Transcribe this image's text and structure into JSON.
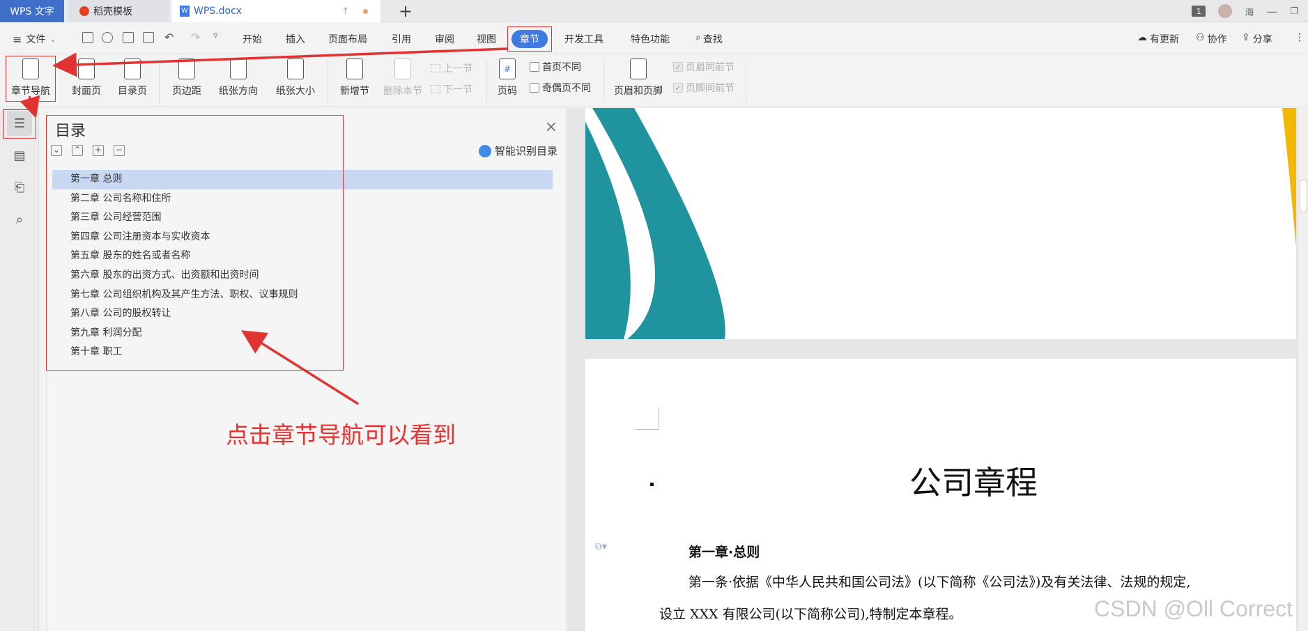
{
  "titlebar": {
    "tabs": [
      {
        "label": "WPS 文字"
      },
      {
        "label": "稻壳模板"
      },
      {
        "label": "WPS.docx"
      }
    ],
    "window_count": "1",
    "user_name": "海",
    "new_tab_icon": "plus-icon"
  },
  "menubar": {
    "file": "文件",
    "items": [
      "开始",
      "插入",
      "页面布局",
      "引用",
      "审阅",
      "视图",
      "章节",
      "开发工具",
      "特色功能",
      "查找"
    ],
    "active_item": "章节",
    "right": {
      "update": "有更新",
      "collab": "协作",
      "share": "分享"
    }
  },
  "ribbon": {
    "section_nav": "章节导航",
    "cover_page": "封面页",
    "toc_page": "目录页",
    "margins": "页边距",
    "orientation": "纸张方向",
    "paper_size": "纸张大小",
    "new_section": "新增节",
    "delete_section": "删除本节",
    "prev_section": "上一节",
    "next_section": "下一节",
    "page_number": "页码",
    "first_page_diff": "首页不同",
    "odd_even_diff": "奇偶页不同",
    "header_footer": "页眉和页脚",
    "header_same_prev": "页眉同前节",
    "footer_same_prev": "页脚同前节"
  },
  "nav_panel": {
    "title": "目录",
    "smart_toc": "智能识别目录",
    "selected_index": 0,
    "items": [
      "第一章  总则",
      "第二章  公司名称和住所",
      "第三章  公司经营范围",
      "第四章  公司注册资本与实收资本",
      "第五章  股东的姓名或者名称",
      "第六章  股东的出资方式、出资额和出资时间",
      "第七章  公司组织机构及其产生方法、职权、议事规则",
      "第八章  公司的股权转让",
      "第九章  利润分配",
      "第十章  职工"
    ]
  },
  "document": {
    "title": "公司章程",
    "heading": "第一章·总则",
    "para_line1": "第一条·依据《中华人民共和国公司法》(以下简称《公司法》)及有关法律、法规的规定,",
    "para_line2": "设立 XXX 有限公司(以下简称公司),特制定本章程。"
  },
  "annotation": {
    "text": "点击章节导航可以看到",
    "color": "#e8322f"
  },
  "watermark": "CSDN @Oll Correct",
  "colors": {
    "accent": "#3f7ae0",
    "teal": "#1f939e",
    "yellow": "#f5b800",
    "selection": "#c8d8f3"
  }
}
